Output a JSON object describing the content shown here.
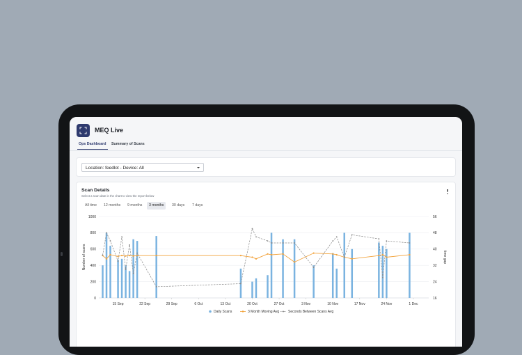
{
  "app": {
    "title": "MEQ Live",
    "logo_icon": "scan-frame-icon",
    "brand_color": "#2e3a6e"
  },
  "tabs": [
    {
      "label": "Ops Dashboard",
      "active": true
    },
    {
      "label": "Summary of Scans",
      "active": false
    }
  ],
  "filter": {
    "location_device": "Location: feedlot - Device: All"
  },
  "scan_details": {
    "title": "Scan Details",
    "subtitle": "Select a scan date in the chart to view the report below",
    "ranges": [
      {
        "label": "All time",
        "active": false
      },
      {
        "label": "12 months",
        "active": false
      },
      {
        "label": "9 months",
        "active": false
      },
      {
        "label": "3 months",
        "active": true
      },
      {
        "label": "30 days",
        "active": false
      },
      {
        "label": "7 days",
        "active": false
      }
    ]
  },
  "chart_data": {
    "type": "bar",
    "x_ticks": [
      "15 Sep",
      "22 Sep",
      "29 Sep",
      "6 Oct",
      "13 Oct",
      "20 Oct",
      "27 Oct",
      "3 Nov",
      "10 Nov",
      "17 Nov",
      "24 Nov",
      "1 Dec"
    ],
    "ylabel": "Number of scans",
    "ylabel_right": "time gap",
    "ylim": [
      0,
      1000
    ],
    "y_ticks": [
      0,
      200,
      400,
      600,
      800,
      1000
    ],
    "ylim_right": [
      16,
      56
    ],
    "y_ticks_right": [
      16,
      24,
      32,
      40,
      48,
      56
    ],
    "colors": {
      "bars": "#7ab3e0",
      "moving_avg": "#f2a33c",
      "gap": "#888888"
    },
    "series": [
      {
        "name": "Daily Scans",
        "type": "bar",
        "x": [
          "11 Sep",
          "12 Sep",
          "13 Sep",
          "15 Sep",
          "16 Sep",
          "17 Sep",
          "18 Sep",
          "19 Sep",
          "20 Sep",
          "25 Sep",
          "17 Oct",
          "20 Oct",
          "21 Oct",
          "24 Oct",
          "25 Oct",
          "28 Oct",
          "31 Oct",
          "5 Nov",
          "10 Nov",
          "11 Nov",
          "13 Nov",
          "15 Nov",
          "22 Nov",
          "23 Nov",
          "24 Nov",
          "30 Nov"
        ],
        "values": [
          400,
          800,
          640,
          470,
          480,
          400,
          330,
          720,
          700,
          760,
          360,
          200,
          240,
          280,
          800,
          720,
          720,
          400,
          550,
          360,
          800,
          600,
          680,
          640,
          600,
          800
        ]
      },
      {
        "name": "3 Month Moving Avg",
        "type": "line",
        "x": [
          "11 Sep",
          "12 Sep",
          "13 Sep",
          "15 Sep",
          "16 Sep",
          "17 Sep",
          "18 Sep",
          "19 Sep",
          "20 Sep",
          "25 Sep",
          "17 Oct",
          "20 Oct",
          "21 Oct",
          "24 Oct",
          "25 Oct",
          "28 Oct",
          "31 Oct",
          "5 Nov",
          "10 Nov",
          "11 Nov",
          "13 Nov",
          "15 Nov",
          "22 Nov",
          "23 Nov",
          "24 Nov",
          "30 Nov"
        ],
        "values": [
          520,
          480,
          530,
          510,
          520,
          515,
          520,
          515,
          520,
          520,
          520,
          500,
          480,
          540,
          530,
          540,
          440,
          550,
          540,
          530,
          500,
          480,
          520,
          530,
          500,
          530
        ]
      },
      {
        "name": "Seconds Between Scans Avg",
        "type": "line",
        "axis": "right",
        "x": [
          "11 Sep",
          "12 Sep",
          "13 Sep",
          "15 Sep",
          "16 Sep",
          "17 Sep",
          "18 Sep",
          "19 Sep",
          "20 Sep",
          "25 Sep",
          "17 Oct",
          "20 Oct",
          "21 Oct",
          "24 Oct",
          "25 Oct",
          "28 Oct",
          "31 Oct",
          "5 Nov",
          "10 Nov",
          "11 Nov",
          "13 Nov",
          "15 Nov",
          "22 Nov",
          "23 Nov",
          "24 Nov",
          "30 Nov"
        ],
        "values": [
          37,
          48,
          44,
          34,
          46,
          30,
          42,
          28,
          38,
          21.5,
          23,
          50,
          46,
          44,
          43,
          43,
          43,
          31,
          44,
          46,
          36,
          47,
          45,
          26,
          44,
          43
        ]
      }
    ]
  }
}
